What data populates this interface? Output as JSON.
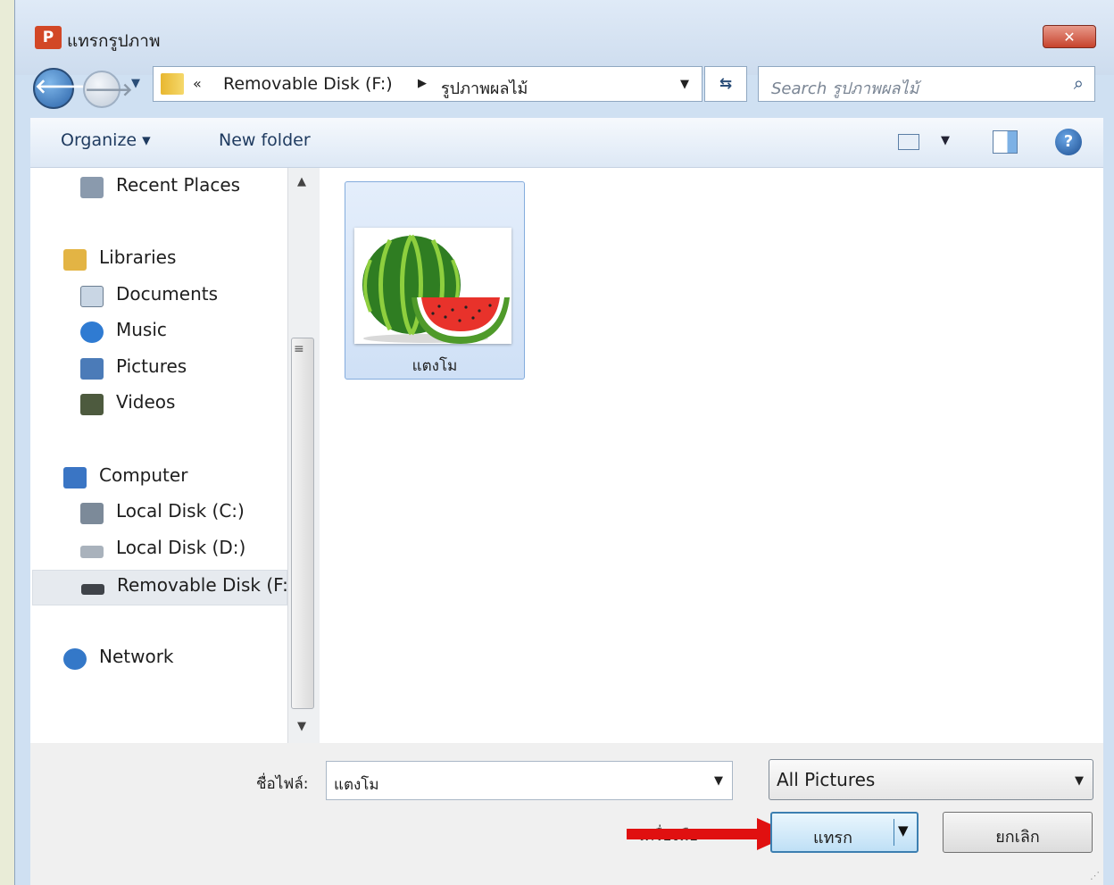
{
  "window": {
    "title": "แทรกรูปภาพ",
    "app_badge": "P",
    "close_label": "✕"
  },
  "address": {
    "crumbs": [
      "Removable Disk (F:)",
      "รูปภาพผลไม้"
    ],
    "search_placeholder": "Search รูปภาพผลไม้"
  },
  "toolbar": {
    "organize_label": "Organize ▾",
    "new_folder_label": "New folder"
  },
  "sidebar": {
    "items": [
      {
        "label": "Recent Places",
        "icon": "recent-places-icon",
        "color": "#8a9aad"
      },
      {
        "label": "Libraries",
        "icon": "libraries-icon",
        "color": "#e3b444"
      },
      {
        "label": "Documents",
        "icon": "documents-icon",
        "color": "#c9d6e4"
      },
      {
        "label": "Music",
        "icon": "music-icon",
        "color": "#2f7bd2"
      },
      {
        "label": "Pictures",
        "icon": "pictures-icon",
        "color": "#4b7bb8"
      },
      {
        "label": "Videos",
        "icon": "videos-icon",
        "color": "#4d5a3e"
      },
      {
        "label": "Computer",
        "icon": "computer-icon",
        "color": "#3a75c4"
      },
      {
        "label": "Local Disk (C:)",
        "icon": "local-disk-c-icon",
        "color": "#7c8a99"
      },
      {
        "label": "Local Disk (D:)",
        "icon": "local-disk-d-icon",
        "color": "#a9b2bc"
      },
      {
        "label": "Removable Disk (F:)",
        "icon": "removable-disk-icon",
        "color": "#3f4349"
      },
      {
        "label": "Network",
        "icon": "network-icon",
        "color": "#3478c8"
      }
    ]
  },
  "files": [
    {
      "name": "แตงโม",
      "thumbnail": "watermelon-icon"
    }
  ],
  "footer": {
    "filename_label": "ชื่อไฟล์:",
    "filename_value": "แตงโม",
    "filter_value": "All Pictures",
    "tools_label": "เครื่องมือ",
    "insert_label": "แทรก",
    "cancel_label": "ยกเลิก"
  },
  "colors": {
    "accent": "#3c7fb1",
    "annotation_arrow": "#e01010"
  }
}
